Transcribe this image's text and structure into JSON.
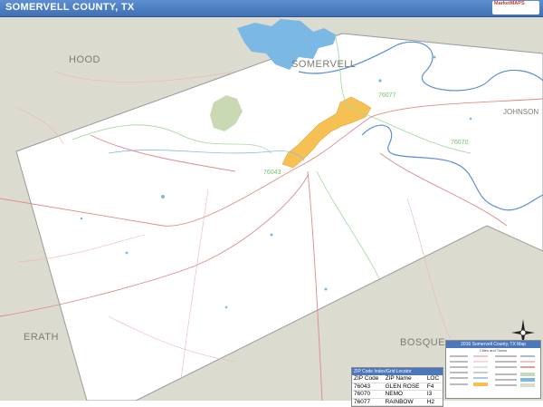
{
  "title": "SOMERVELL COUNTY, TX",
  "logo_text": "MarketMAPS",
  "counties": {
    "hood": "HOOD",
    "somervell": "SOMERVELL",
    "johnson": "JOHNSON",
    "erath": "ERATH",
    "bosque": "BOSQUE"
  },
  "zip_labels": {
    "z76077": "76077",
    "z76070": "76070",
    "z76043": "76043"
  },
  "zip_table": {
    "header": "ZIP Code Index/Grid Locator",
    "columns": [
      "ZIP Code",
      "ZIP Name",
      "LOC"
    ],
    "rows": [
      {
        "zip": "76043",
        "name": "GLEN ROSE",
        "loc": "F4"
      },
      {
        "zip": "76070",
        "name": "NEMO",
        "loc": "I3"
      },
      {
        "zip": "76077",
        "name": "RAINBOW",
        "loc": "H2"
      }
    ]
  },
  "legend": {
    "header": "2016 Somervell County, TX Map",
    "subheader": "Cities and Towns"
  },
  "colors": {
    "county_fill": "#ffffff",
    "outside_fill": "#dcdbd0",
    "city_fill": "#f6c052",
    "water": "#7bb8e4",
    "park": "#c8d9b4",
    "roads": "#e08a8a",
    "zip_boundary": "#9fd89f",
    "river": "#5a8ed6"
  },
  "icons": {
    "compass": "compass-rose-icon"
  }
}
